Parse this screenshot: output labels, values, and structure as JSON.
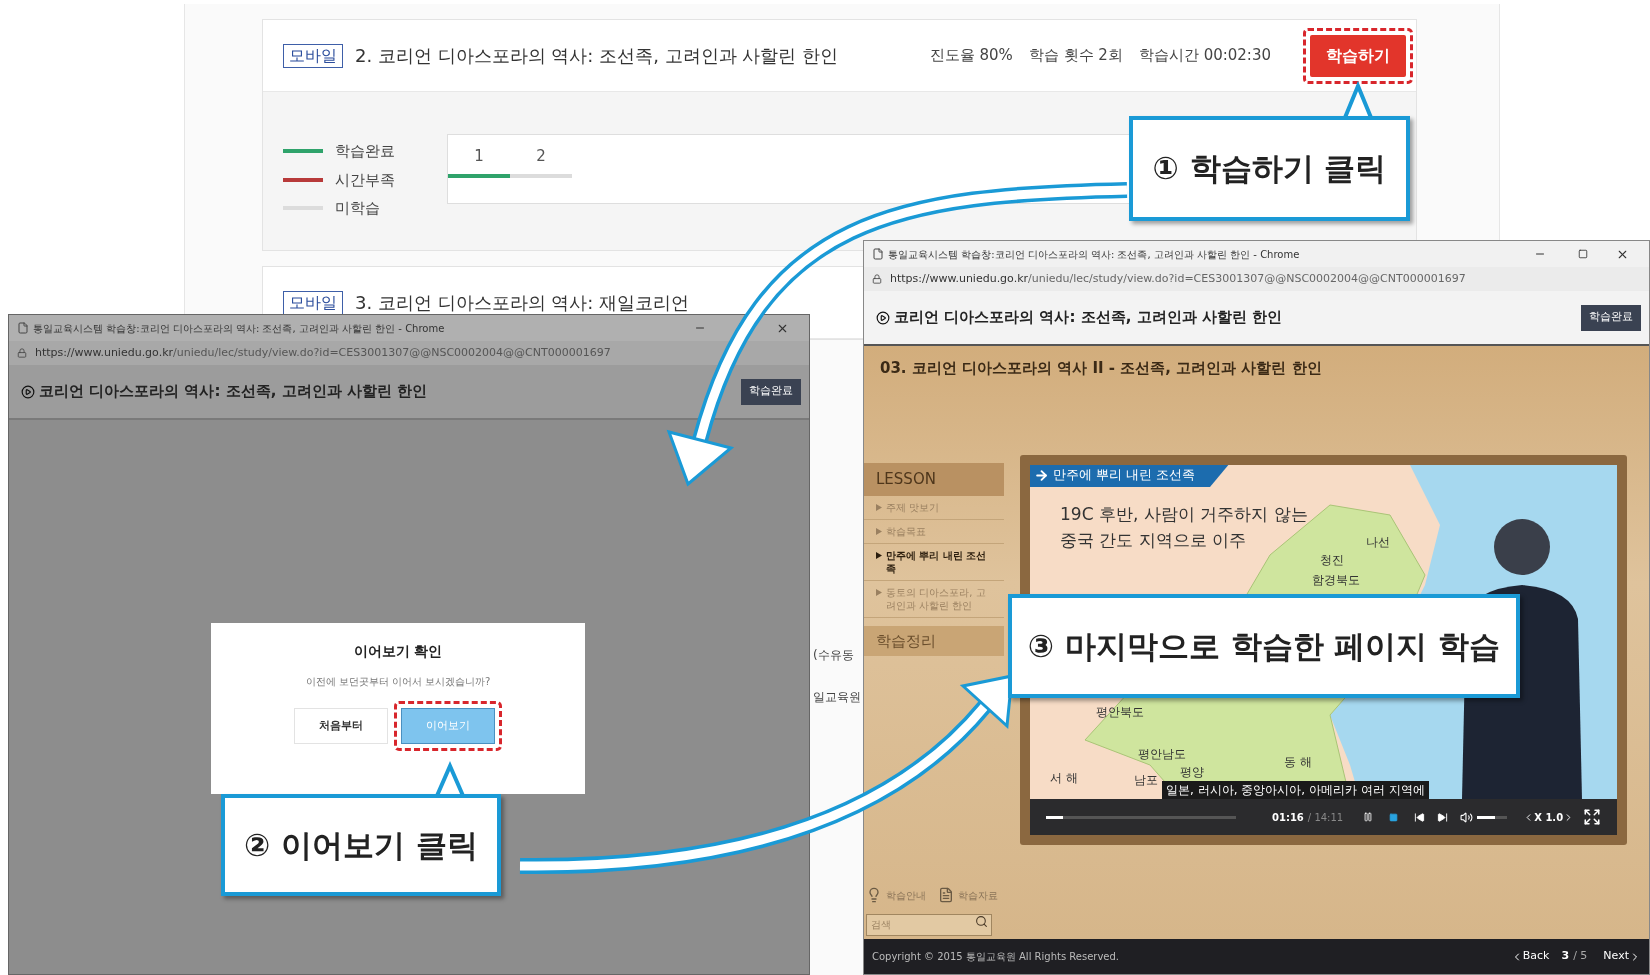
{
  "course_list": {
    "courses": [
      {
        "badge": "모바일",
        "title": "2. 코리언 디아스포라의 역사: 조선족, 고려인과 사할린 한인",
        "stats": [
          "진도율 80%",
          "학습 횟수 2회",
          "학습시간 00:02:30"
        ],
        "button": "학습하기",
        "button_highlighted": true,
        "expanded": true,
        "legend": [
          {
            "label": "학습완료",
            "color": "#2fa36b"
          },
          {
            "label": "시간부족",
            "color": "#b83a3a"
          },
          {
            "label": "미학습",
            "color": "#dcdcdc"
          }
        ],
        "pages": [
          {
            "label": "1",
            "color": "#2fa36b"
          },
          {
            "label": "2",
            "color": "#dcdcdc"
          }
        ]
      },
      {
        "badge": "모바일",
        "title": "3. 코리언 디아스포라의 역사: 재일코리언",
        "expanded": false
      }
    ]
  },
  "background_fragments": [
    "(수유동",
    "일교육원"
  ],
  "left_window": {
    "dimmed": true,
    "tab_title": "통일교육시스템 학습창:코리언 디아스포라의 역사: 조선족, 고려인과 사할린 한인 - Chrome",
    "url_host": "https://www.uniedu.go.kr",
    "url_path": "/uniedu/lec/study/view.do?id=CES3001307@@NSC0002004@@CNT000001697",
    "header_title": "코리언 디아스포라의 역사: 조선족, 고려인과 사할린 한인",
    "complete_button": "학습완료",
    "dialog": {
      "title": "이어보기 확인",
      "message": "이전에 보던곳부터 이어서 보시겠습니까?",
      "buttons": [
        {
          "label": "처음부터",
          "selected": false,
          "highlighted": false
        },
        {
          "label": "이어보기",
          "selected": true,
          "highlighted": true
        }
      ]
    }
  },
  "right_window": {
    "dimmed": false,
    "tab_title": "통일교육시스템 학습창:코리언 디아스포라의 역사: 조선족, 고려인과 사할린 한인 - Chrome",
    "url_host": "https://www.uniedu.go.kr",
    "url_path": "/uniedu/lec/study/view.do?id=CES3001307@@NSC0002004@@CNT000001697",
    "header_title": "코리언 디아스포라의 역사: 조선족, 고려인과 사할린 한인",
    "complete_button": "학습완료",
    "lesson_title": "03. 코리언 디아스포라의 역사 II - 조선족, 고려인과 사할린 한인",
    "sidebar": {
      "header": "LESSON",
      "items": [
        {
          "label": "주제 맛보기",
          "selected": false
        },
        {
          "label": "학습목표",
          "selected": false
        },
        {
          "label": "만주에 뿌리 내린 조선족",
          "selected": true
        },
        {
          "label": "동토의 디아스포라, 고려인과 사할린 한인",
          "selected": false
        }
      ],
      "summary": "학습정리",
      "tools": [
        "학습안내",
        "학습자료"
      ],
      "search_placeholder": "검색"
    },
    "video": {
      "banner": "만주에 뿌리 내린 조선족",
      "caption": [
        "19C 후반, 사람이 거주하지 않는",
        "중국 간도 지역으로 이주"
      ],
      "map_labels": [
        "나선",
        "청진",
        "함경북도",
        "평안북도",
        "평안남도",
        "동 해",
        "서 해",
        "남포",
        "평양"
      ],
      "subtitle": "일본, 러시아, 중앙아시아, 아메리카 여러 지역에",
      "progress": {
        "level": 0.09
      },
      "time_current": "01:16",
      "time_total": "/ 14:11",
      "volume": {
        "level": 0.6
      },
      "speed": "X 1.0"
    },
    "footer": {
      "copyright": "Copyright © 2015 통일교육원 All Rights Reserved.",
      "back": "Back",
      "page_current": "3",
      "page_total": "/ 5",
      "next": "Next"
    }
  },
  "callouts": [
    {
      "text": "① 학습하기 클릭"
    },
    {
      "text": "② 이어보기 클릭"
    },
    {
      "text": "③ 마지막으로 학습한 페이지 학습"
    }
  ]
}
